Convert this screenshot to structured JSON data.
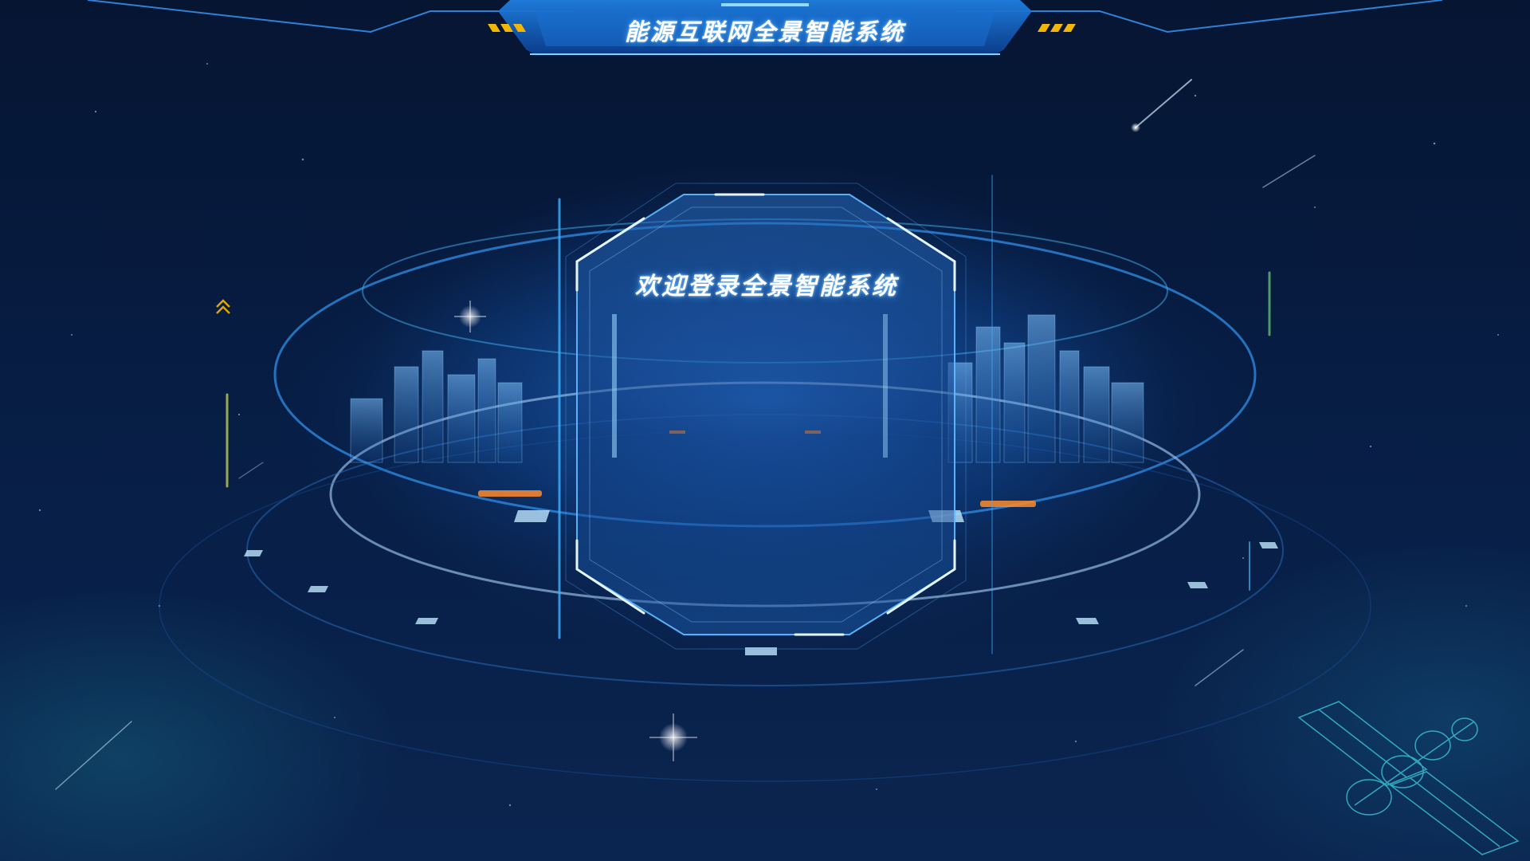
{
  "header": {
    "title": "能源互联网全景智能系统",
    "icons": [
      "chevron-stripes-left",
      "chevron-stripes-right"
    ]
  },
  "login_panel": {
    "welcome_text": "欢迎登录全景智能系统"
  },
  "decor": {
    "icons": [
      "city-hologram",
      "satellite-icon",
      "up-chevron-icon",
      "star-sparkle-icon"
    ]
  },
  "colors": {
    "background": "#041535",
    "accent": "#3aa0ff",
    "glow": "#5fd2ff",
    "warning_stripe": "#f2b705",
    "orange_glow": "#ff8a2a"
  }
}
